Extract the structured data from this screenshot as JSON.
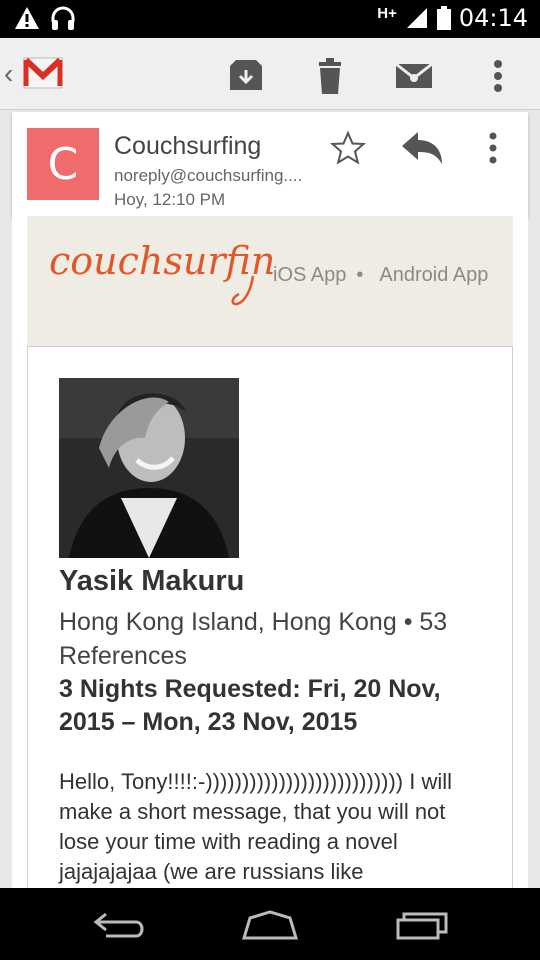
{
  "status_bar": {
    "network": "H+",
    "time": "04:14",
    "icons": [
      "warning-icon",
      "headset-icon",
      "signal-icon",
      "battery-icon"
    ]
  },
  "toolbar": {
    "icons": [
      "back-chevron-icon",
      "gmail-logo",
      "archive-icon",
      "trash-icon",
      "mark-unread-icon",
      "overflow-menu-icon"
    ]
  },
  "message_header": {
    "avatar_letter": "C",
    "sender": "Couchsurfing",
    "email": "noreply@couchsurfing....",
    "date": "Hoy, 12:10 PM",
    "avatar_color": "#f06b6b"
  },
  "email_body": {
    "brand": "couchsurfing",
    "brand_color": "#e2572a",
    "ios_link": "iOS App",
    "separator": "•",
    "android_link": "Android App",
    "profile": {
      "name": "Yasik Makuru",
      "location": "Hong Kong Island, Hong Kong • 53 References",
      "request": "3 Nights Requested: Fri, 20 Nov, 2015 – Mon, 23 Nov, 2015",
      "message": "Hello, Tony!!!!:-))))))))))))))))))))))))))) I will make a short message, that you will not lose your time with reading a novel jajajajajaa (we are russians like"
    }
  }
}
